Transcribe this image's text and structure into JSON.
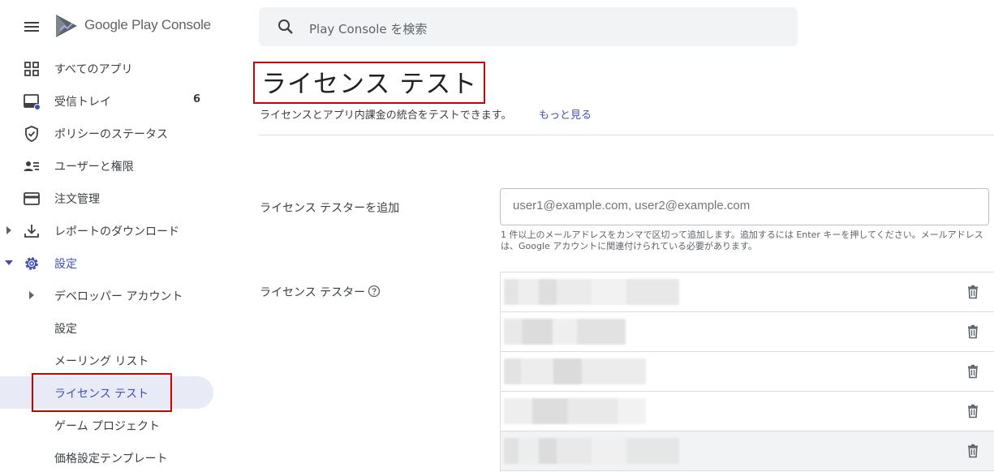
{
  "app": {
    "brand": "Google Play Console",
    "menu_icon": "hamburger-menu-icon",
    "logo_icon": "play-console-logo-icon"
  },
  "search": {
    "placeholder": "Play Console を検索",
    "icon": "search-icon"
  },
  "sidebar": {
    "items": [
      {
        "label": "すべてのアプリ",
        "icon": "apps-grid-icon"
      },
      {
        "label": "受信トレイ",
        "icon": "inbox-icon",
        "count": "6"
      },
      {
        "label": "ポリシーのステータス",
        "icon": "shield-check-icon"
      },
      {
        "label": "ユーザーと権限",
        "icon": "users-permissions-icon"
      },
      {
        "label": "注文管理",
        "icon": "credit-card-icon"
      },
      {
        "label": "レポートのダウンロード",
        "icon": "download-icon"
      },
      {
        "label": "設定",
        "icon": "gear-icon"
      },
      {
        "label": "デベロッパー アカウント"
      },
      {
        "label": "設定"
      },
      {
        "label": "メーリング リスト"
      },
      {
        "label": "ライセンス テスト"
      },
      {
        "label": "ゲーム プロジェクト"
      },
      {
        "label": "価格設定テンプレート"
      }
    ]
  },
  "main": {
    "title": "ライセンス テスト",
    "description": "ライセンスとアプリ内課金の統合をテストできます。",
    "learn_more": "もっと見る",
    "add_testers_label": "ライセンス テスターを追加",
    "email_placeholder": "user1@example.com, user2@example.com",
    "hint": "1 件以上のメールアドレスをカンマで区切って追加します。追加するには Enter キーを押してください。メールアドレスは、Google アカウントに関連付けられている必要があります。",
    "testers_label": "ライセンス テスター",
    "testers_count_rows": 5
  },
  "colors": {
    "accent": "#3f51b5",
    "active_bg": "#e8eaf6",
    "highlight_box": "#cc0000"
  }
}
